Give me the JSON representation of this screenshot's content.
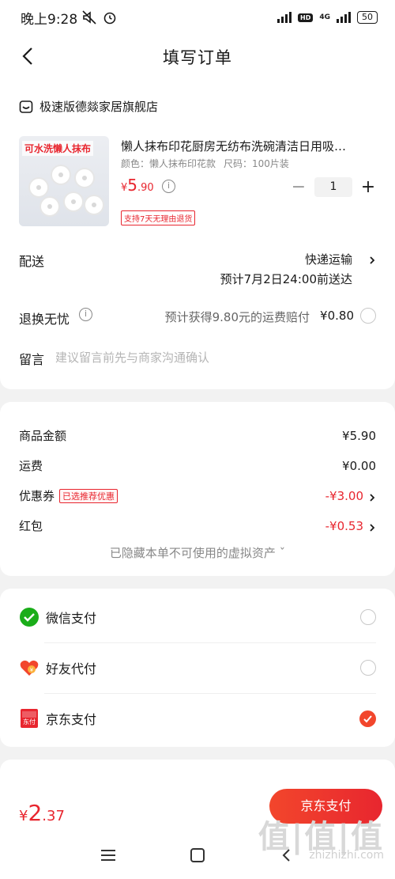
{
  "status_bar": {
    "time": "晚上9:28",
    "network": "4G",
    "hd": "HD",
    "battery": "50"
  },
  "header": {
    "title": "填写订单"
  },
  "shop": {
    "name": "极速版德燚家居旗舰店"
  },
  "product": {
    "image_banner": "可水洗懒人抹布",
    "title": "懒人抹布印花厨房无纺布洗碗清洁日用吸…",
    "color": "颜色：懒人抹布印花款",
    "size": "尺码：100片装",
    "price_symbol": "¥",
    "price_int": "5",
    "price_dec": ".90",
    "quantity": "1",
    "return_tag": "支持7天无理由退货"
  },
  "delivery": {
    "label": "配送",
    "method": "快递运输",
    "eta": "预计7月2日24:00前送达"
  },
  "return_service": {
    "label": "退换无忧",
    "desc": "预计获得9.80元的运费赔付",
    "price": "¥0.80"
  },
  "note": {
    "label": "留言",
    "placeholder": "建议留言前先与商家沟通确认"
  },
  "summary": {
    "goods_label": "商品金额",
    "goods_value": "¥5.90",
    "shipping_label": "运费",
    "shipping_value": "¥0.00",
    "coupon_label": "优惠券",
    "coupon_badge": "已选推荐优惠",
    "coupon_value": "-¥3.00",
    "redpacket_label": "红包",
    "redpacket_value": "-¥0.53",
    "hidden_assets": "已隐藏本单不可使用的虚拟资产 ˇ"
  },
  "payment": {
    "methods": [
      {
        "label": "微信支付",
        "selected": false
      },
      {
        "label": "好友代付",
        "selected": false
      },
      {
        "label": "京东支付",
        "selected": true
      }
    ],
    "jd_icon_text": "东付"
  },
  "bottom": {
    "total_symbol": "¥",
    "total_int": "2",
    "total_dec": ".37",
    "pay_button": "京东支付",
    "watermark": "值|值|值",
    "watermark_url": "zhizhizhi.com"
  },
  "colors": {
    "accent": "#e8262f",
    "pay_button": "#f2462c",
    "wechat": "#1aad19"
  }
}
